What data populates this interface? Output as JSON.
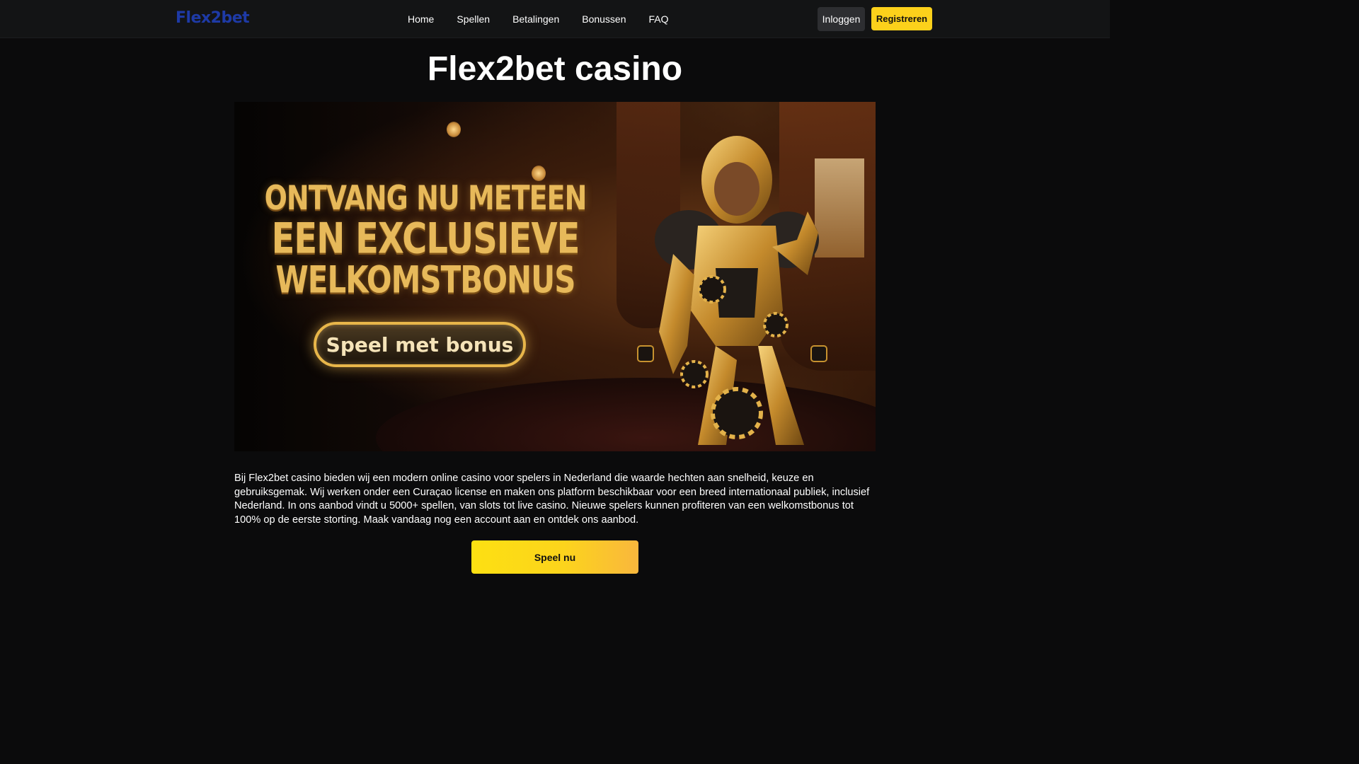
{
  "header": {
    "logo": "Flex2bet",
    "nav": [
      "Home",
      "Spellen",
      "Betalingen",
      "Bonussen",
      "FAQ"
    ],
    "login_label": "Inloggen",
    "register_label": "Registreren"
  },
  "main": {
    "title": "Flex2bet casino",
    "banner": {
      "headline_line1": "ONTVANG NU METEEN",
      "headline_line2": "EEN EXCLUSIEVE",
      "headline_line3": "WELKOMSTBONUS",
      "cta_label": "Speel met bonus"
    },
    "intro": "Bij Flex2bet casino bieden wij een modern online casino voor spelers in Nederland die waarde hechten aan snelheid, keuze en gebruiksgemak. Wij werken onder een Curaçao license en maken ons platform beschikbaar voor een breed internationaal publiek, inclusief Nederland. In ons aanbod vindt u 5000+ spellen, van slots tot live casino. Nieuwe spelers kunnen profiteren van een welkomstbonus tot 100% op de eerste storting. Maak vandaag nog een account aan en ontdek ons aanbod.",
    "play_label": "Speel nu"
  },
  "colors": {
    "background": "#0b0b0c",
    "header_bg": "#131415",
    "logo": "#1e3aa6",
    "accent_yellow": "#fcd11b",
    "gold_text": "#e7b95a"
  }
}
